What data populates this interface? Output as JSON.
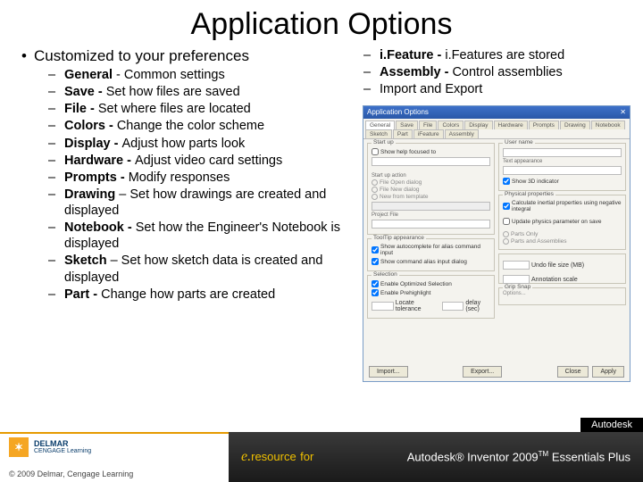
{
  "title": "Application Options",
  "left_heading": "Customized to your preferences",
  "left_items": [
    {
      "label": "General",
      "sep": " - ",
      "desc": "Common settings"
    },
    {
      "label": "Save - ",
      "sep": "",
      "desc": "Set how files are saved"
    },
    {
      "label": "File - ",
      "sep": "",
      "desc": "Set where files are located"
    },
    {
      "label": "Colors - ",
      "sep": "",
      "desc": "Change the color scheme"
    },
    {
      "label": "Display - ",
      "sep": "",
      "desc": "Adjust how parts look"
    },
    {
      "label": "Hardware - ",
      "sep": "",
      "desc": "Adjust video card settings"
    },
    {
      "label": "Prompts - ",
      "sep": "",
      "desc": "Modify responses"
    },
    {
      "label": "Drawing ",
      "sep": "– ",
      "desc": "Set how drawings are created and displayed"
    },
    {
      "label": "Notebook - ",
      "sep": "",
      "desc": "Set how the Engineer's Notebook is displayed"
    },
    {
      "label": "Sketch ",
      "sep": "– ",
      "desc": "Set how sketch data is created and displayed"
    },
    {
      "label": "Part - ",
      "sep": "",
      "desc": "Change how parts are created"
    }
  ],
  "right_items": [
    {
      "label": "i.Feature - ",
      "desc": "i.Features are stored"
    },
    {
      "label": "Assembly - ",
      "desc": "Control assemblies"
    },
    {
      "label": "",
      "desc": "Import and Export"
    }
  ],
  "dialog": {
    "title": "Application Options",
    "tabs": [
      "General",
      "Save",
      "File",
      "Colors",
      "Display",
      "Hardware",
      "Prompts",
      "Drawing",
      "Notebook",
      "Sketch",
      "Part",
      "iFeature",
      "Assembly"
    ],
    "buttons": {
      "import": "Import...",
      "export": "Export...",
      "close": "Close",
      "apply": "Apply"
    }
  },
  "footer": {
    "brand1": "DELMAR",
    "brand2": "CENGAGE Learning",
    "copyright": "© 2009 Delmar, Cengage Learning",
    "eresource": "resource",
    "for": "for",
    "product": "Autodesk® Inventor 2009",
    "suffix": "Essentials Plus",
    "autodesk": "Autodesk"
  }
}
